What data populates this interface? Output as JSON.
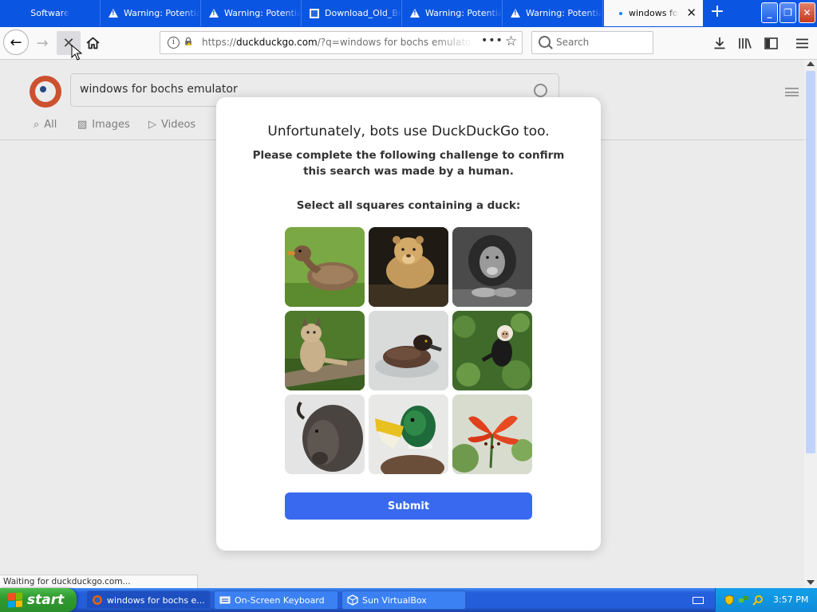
{
  "browser": {
    "tabs": [
      {
        "label": "Software",
        "icon": "none"
      },
      {
        "label": "Warning: Potential Security Risk Ahead",
        "icon": "warning-icon"
      },
      {
        "label": "Warning: Potential Security Risk Ahead",
        "icon": "warning-icon"
      },
      {
        "label": "Download_Old_Browsers",
        "icon": "page-icon"
      },
      {
        "label": "Warning: Potential Security Risk Ahead",
        "icon": "warning-icon"
      },
      {
        "label": "Warning: Potential Security Risk Ahead",
        "icon": "warning-icon"
      },
      {
        "label": "windows for bochs emulator",
        "icon": "loading-dot",
        "active": true
      }
    ],
    "new_tab": "+",
    "window_buttons": {
      "minimize": "_",
      "restore": "❐",
      "close": "✕"
    },
    "url": {
      "prefix": "https://",
      "domain": "duckduckgo.com",
      "rest": "/?q=windows for bochs emulator&t=ffab&ia=web"
    },
    "search_placeholder": "Search",
    "status_text": "Waiting for duckduckgo.com..."
  },
  "ddg": {
    "query": "windows for bochs emulator",
    "tabs": [
      {
        "label": "All",
        "icon": "search-icon"
      },
      {
        "label": "Images",
        "icon": "image-icon"
      },
      {
        "label": "Videos",
        "icon": "play-icon"
      }
    ]
  },
  "challenge": {
    "title": "Unfortunately, bots use DuckDuckGo too.",
    "subtitle": "Please complete the following challenge to confirm this search was made by a human.",
    "instruction": "Select all squares containing a duck:",
    "images": [
      {
        "subject": "duck",
        "contains_duck": true
      },
      {
        "subject": "lioness",
        "contains_duck": false
      },
      {
        "subject": "lion",
        "contains_duck": false
      },
      {
        "subject": "lynx",
        "contains_duck": false
      },
      {
        "subject": "duck",
        "contains_duck": true
      },
      {
        "subject": "monkey",
        "contains_duck": false
      },
      {
        "subject": "bison",
        "contains_duck": false
      },
      {
        "subject": "duck",
        "contains_duck": true
      },
      {
        "subject": "flower",
        "contains_duck": false
      }
    ],
    "submit_label": "Submit"
  },
  "taskbar": {
    "start_label": "start",
    "items": [
      {
        "label": "windows for bochs e...",
        "active": true
      },
      {
        "label": "On-Screen Keyboard",
        "active": false
      },
      {
        "label": "Sun VirtualBox",
        "active": false
      }
    ],
    "clock": "3:57 PM"
  },
  "colors": {
    "xp_blue": "#0a55e2",
    "submit_blue": "#3969ef",
    "ddg_orange": "#de5833",
    "start_green": "#2f9a2f"
  }
}
